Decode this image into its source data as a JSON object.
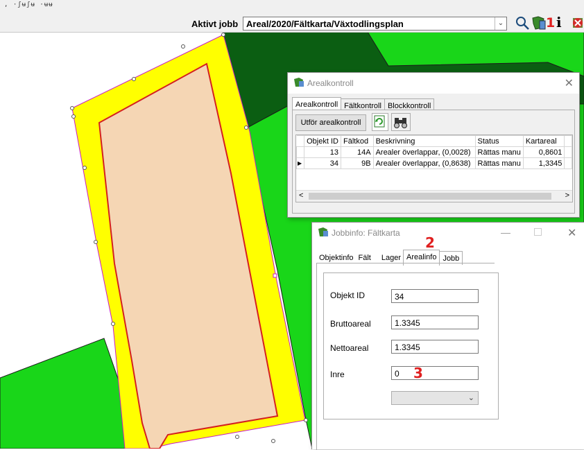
{
  "toolbar": {
    "scrap_text": ", ·ʃʉʃʉ  ·ʉʉ",
    "active_job_label": "Aktivt jobb",
    "active_job_value": "Areal/2020/Fältkarta/Växtodlingsplan",
    "step_marker_1": "1",
    "info_button_label": "i"
  },
  "arealkontroll": {
    "title": "Arealkontroll",
    "tabs": [
      "Arealkontroll",
      "Fältkontroll",
      "Blockkontroll"
    ],
    "run_button": "Utför arealkontroll",
    "columns": [
      "Objekt ID",
      "Fältkod",
      "Beskrivning",
      "Status",
      "Kartareal"
    ],
    "rows": [
      {
        "objekt_id": "13",
        "faltkod": "14A",
        "beskrivning": "Arealer överlappar, (0,0028)",
        "status": "Rättas manu",
        "kartareal": "0,8601"
      },
      {
        "objekt_id": "34",
        "faltkod": "9B",
        "beskrivning": "Arealer överlappar, (0,8638)",
        "status": "Rättas manu",
        "kartareal": "1,3345"
      }
    ],
    "scroll_left": "<",
    "scroll_right": ">"
  },
  "jobbinfo": {
    "title": "Jobbinfo: Fältkarta",
    "tabs": [
      "Objektinfo",
      "Fält",
      "Lager",
      "Arealinfo",
      "Jobb"
    ],
    "step_marker_2": "2",
    "step_marker_3": "3",
    "fields": {
      "objekt_id_label": "Objekt ID",
      "objekt_id_value": "34",
      "bruttoareal_label": "Bruttoareal",
      "bruttoareal_value": "1.3345",
      "nettoareal_label": "Nettoareal",
      "nettoareal_value": "1.3345",
      "inre_label": "Inre",
      "inre_value": "0"
    }
  },
  "colors": {
    "field_green": "#19d619",
    "dark_green": "#0b5e12",
    "buffer_yellow": "#ffff00",
    "parcel_fill": "#f5d6b4",
    "boundary_red": "#d42020",
    "marker_red": "#e02020"
  }
}
